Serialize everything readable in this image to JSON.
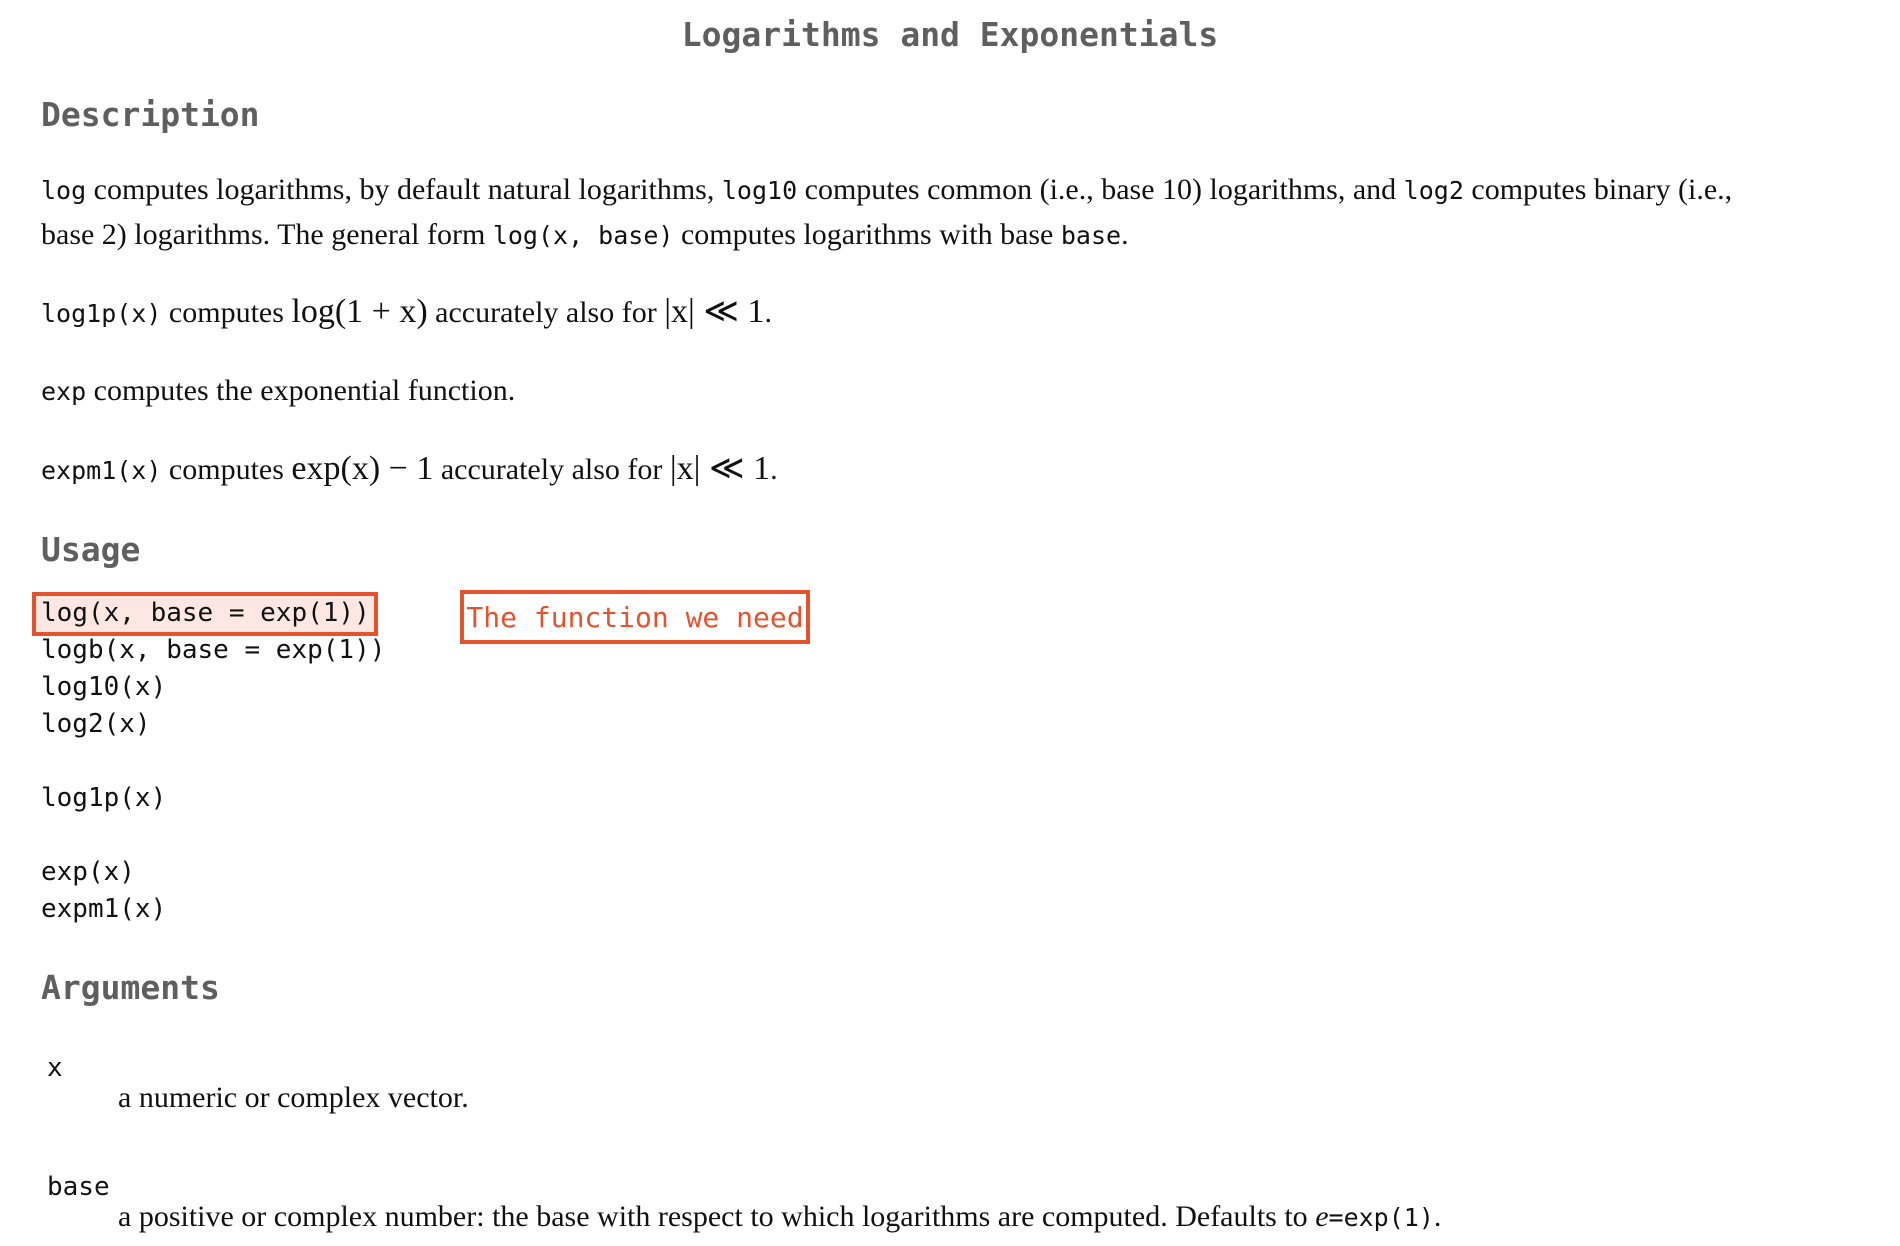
{
  "title": "Logarithms and Exponentials",
  "sections": {
    "description": "Description",
    "usage": "Usage",
    "arguments": "Arguments"
  },
  "description": {
    "p1": {
      "c_log": "log",
      "t1": " computes logarithms, by default natural logarithms, ",
      "c_log10": "log10",
      "t2": " computes common (i.e., base 10) logarithms, and ",
      "c_log2": "log2",
      "t3": " computes binary (i.e.,",
      "t4": "base 2) logarithms. The general form ",
      "c_form": "log(x, base)",
      "t5": " computes logarithms with base ",
      "c_base": "base",
      "t6": "."
    },
    "p2": {
      "c_fn": "log1p(x)",
      "t1": " computes ",
      "math": "log(1 + x)",
      "t2": " accurately also for ",
      "cond": "|x| ≪ 1",
      "t3": "."
    },
    "p3": {
      "c_fn": "exp",
      "t1": " computes the exponential function."
    },
    "p4": {
      "c_fn": "expm1(x)",
      "t1": " computes ",
      "math": "exp(x) − 1",
      "t2": " accurately also for ",
      "cond": "|x| ≪ 1",
      "t3": "."
    }
  },
  "usage": {
    "lines": [
      "log(x, base = exp(1))",
      "logb(x, base = exp(1))",
      "log10(x)",
      "log2(x)",
      "log1p(x)",
      "exp(x)",
      "expm1(x)"
    ],
    "callout": "The function we need",
    "accent_color": "#e4522e"
  },
  "arguments": [
    {
      "name": "x",
      "desc": "a numeric or complex vector."
    },
    {
      "name": "base",
      "desc_text": "a positive or complex number: the base with respect to which logarithms are computed. Defaults to ",
      "desc_math": "e",
      "desc_code": "=exp(1)",
      "desc_end": "."
    }
  ]
}
